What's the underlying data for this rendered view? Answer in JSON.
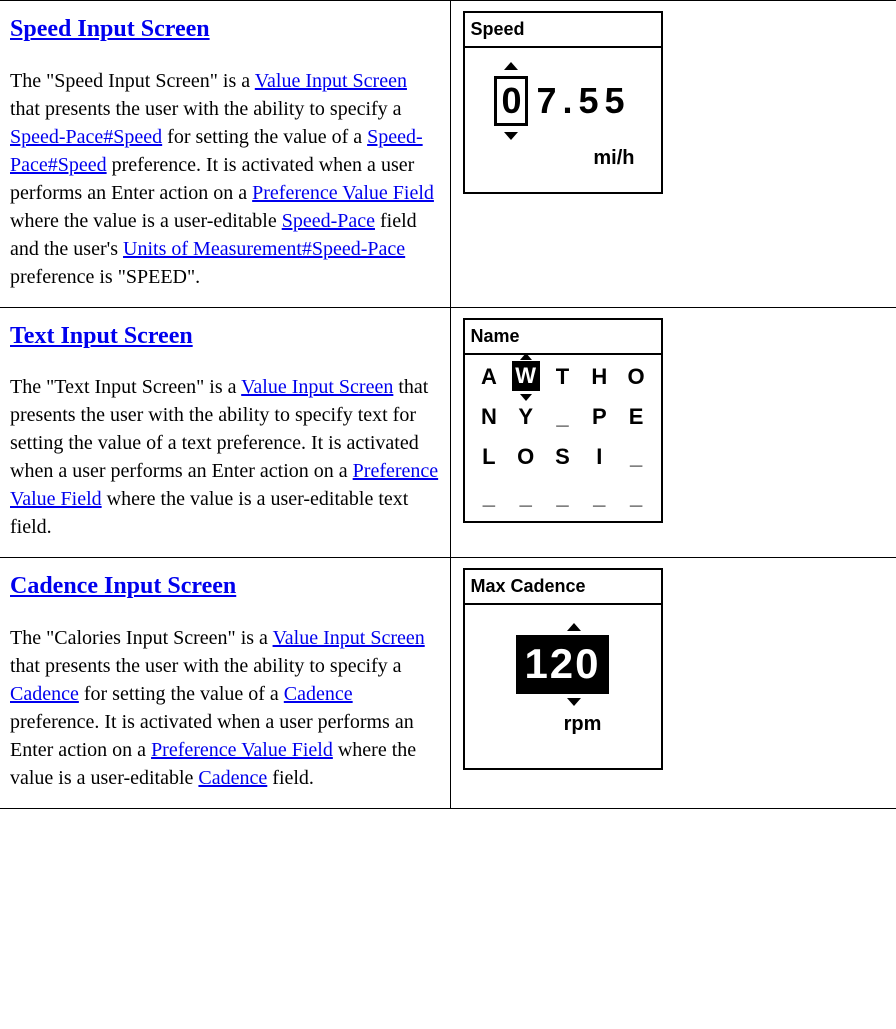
{
  "rows": [
    {
      "heading": "Speed Input Screen",
      "desc": {
        "p1a": "The \"Speed Input Screen\" is a ",
        "link_vis": "Value Input Screen",
        "p1b": " that presents the user with the ability to specify a ",
        "link_speed1": "Speed-Pace#Speed",
        "p1c": " for setting the value of a ",
        "link_speed2": "Speed-Pace#Speed",
        "p1d": " preference. It is activated when a user performs an Enter action on a ",
        "link_pvf": "Preference Value Field",
        "p1e": " where the value is a user-editable ",
        "link_sp": "Speed-Pace",
        "p1f": " field and the user's ",
        "link_uom": "Units of Measurement#Speed-Pace",
        "p1g": " preference is \"SPEED\"."
      },
      "device": {
        "title": "Speed",
        "spinner_digit": "0",
        "rest_digits": "7.55",
        "unit": "mi/h"
      }
    },
    {
      "heading": "Text Input Screen",
      "desc": {
        "p1a": "The \"Text Input Screen\" is a ",
        "link_vis": "Value Input Screen",
        "p1b": " that presents the user with the ability to specify text for setting the value of a text preference. It is activated when a user performs an Enter action on a ",
        "link_pvf": "Preference Value Field",
        "p1c": " where the value is a user-editable text field."
      },
      "device": {
        "title": "Name",
        "grid": [
          [
            "A",
            "W",
            "T",
            "H",
            "O"
          ],
          [
            "N",
            "Y",
            "_",
            "P",
            "E"
          ],
          [
            "L",
            "O",
            "S",
            "I",
            "_"
          ],
          [
            "_",
            "_",
            "_",
            "_",
            "_"
          ]
        ],
        "selected_row": 0,
        "selected_col": 1
      }
    },
    {
      "heading": "Cadence Input Screen",
      "desc": {
        "p1a": "The \"Calories Input Screen\" is a ",
        "link_vis": "Value Input Screen",
        "p1b": " that presents the user with the ability to specify a ",
        "link_cad1": "Cadence",
        "p1c": " for setting the value of a ",
        "link_cad2": "Cadence",
        "p1d": " preference. It is activated when a user performs an Enter action on a ",
        "link_pvf": "Preference Value Field",
        "p1e": " where the value is a user-editable ",
        "link_cad3": "Cadence",
        "p1f": " field."
      },
      "device": {
        "title": "Max Cadence",
        "value": "120",
        "unit": "rpm"
      }
    }
  ]
}
